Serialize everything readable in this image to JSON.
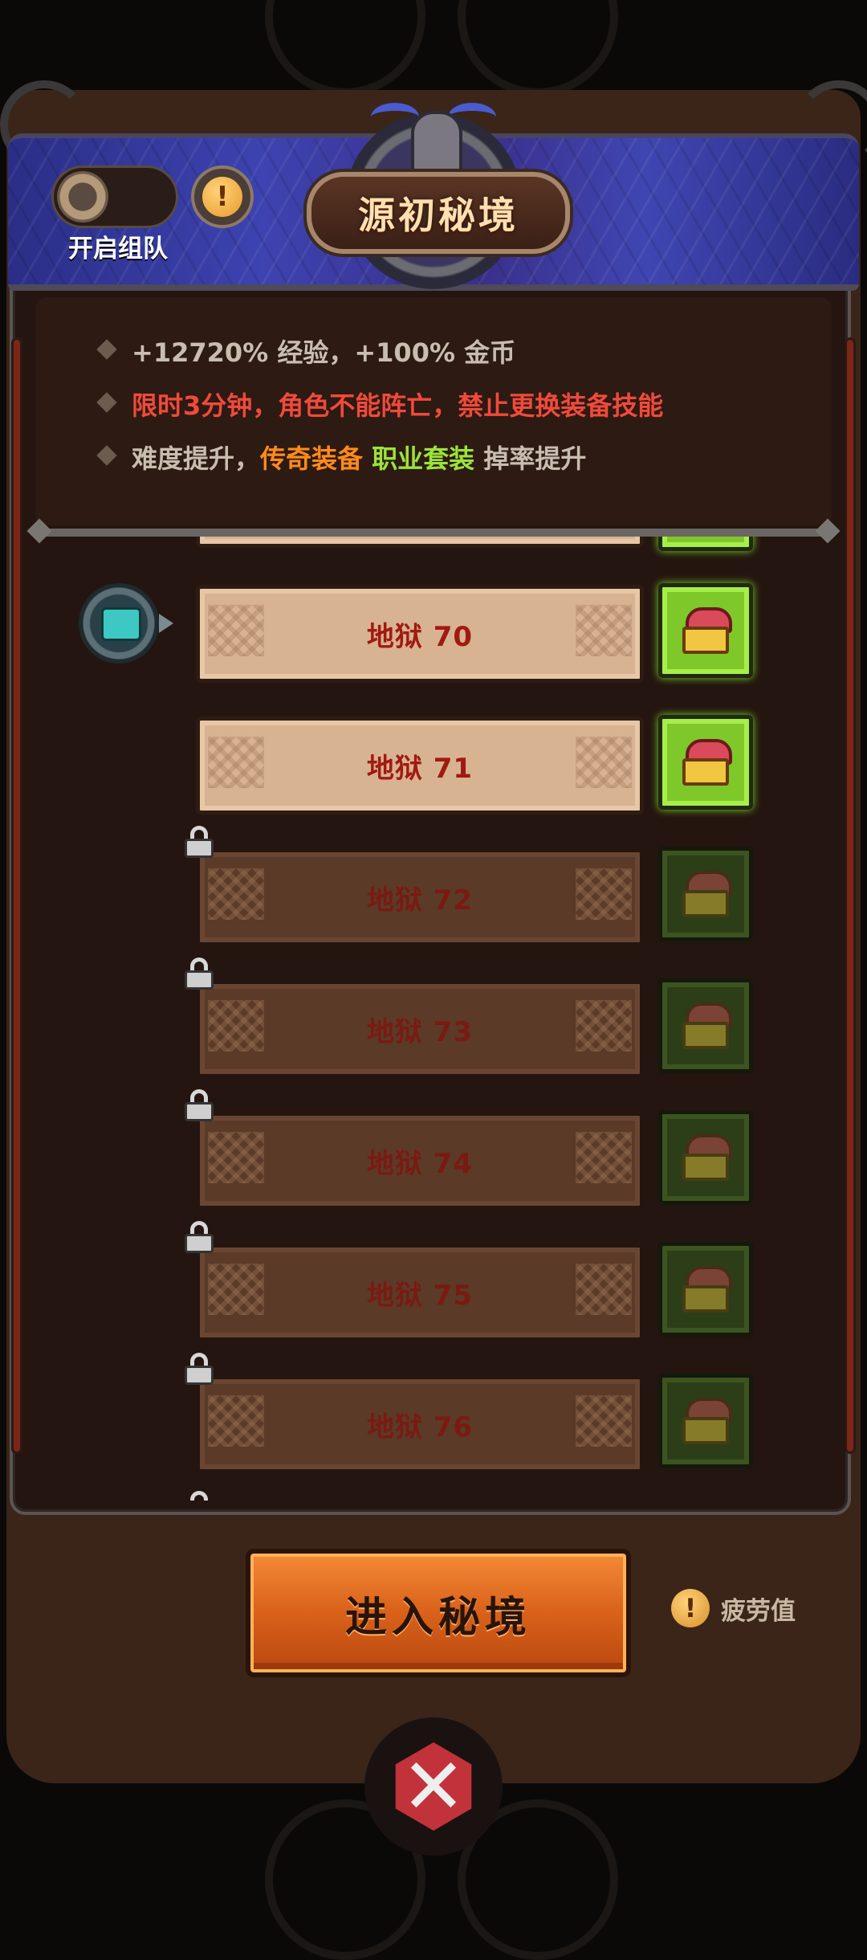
{
  "header": {
    "title": "源初秘境",
    "team_toggle_label": "开启组队",
    "info_glyph": "!"
  },
  "info": {
    "line1": "+12720% 经验，+100% 金币",
    "line2": "限时3分钟，角色不能阵亡，禁止更换装备技能",
    "line3_prefix": "难度提升，",
    "line3_legendary": "传奇装备",
    "line3_set": "职业套装",
    "line3_suffix": "掉率提升"
  },
  "levels": [
    {
      "label": "地狱 70",
      "locked": false,
      "current": true
    },
    {
      "label": "地狱 71",
      "locked": false,
      "current": false
    },
    {
      "label": "地狱 72",
      "locked": true,
      "current": false
    },
    {
      "label": "地狱 73",
      "locked": true,
      "current": false
    },
    {
      "label": "地狱 74",
      "locked": true,
      "current": false
    },
    {
      "label": "地狱 75",
      "locked": true,
      "current": false
    },
    {
      "label": "地狱 76",
      "locked": true,
      "current": false
    }
  ],
  "footer": {
    "enter_button": "进入秘境",
    "fatigue_label": "疲劳值",
    "fatigue_glyph": "!",
    "close_glyph": "✕"
  },
  "colors": {
    "header_blue": "#3d43b0",
    "level_text": "#a11a12",
    "reward_green": "#7ec82a",
    "enter_orange": "#d9611a",
    "warning_red": "#f04a3a",
    "legendary_orange": "#ff8a1c",
    "set_green": "#9be33a"
  },
  "icons": [
    "team-toggle-icon",
    "info-icon",
    "lock-icon",
    "chest-icon",
    "anvil-icon",
    "fatigue-info-icon",
    "close-icon"
  ]
}
